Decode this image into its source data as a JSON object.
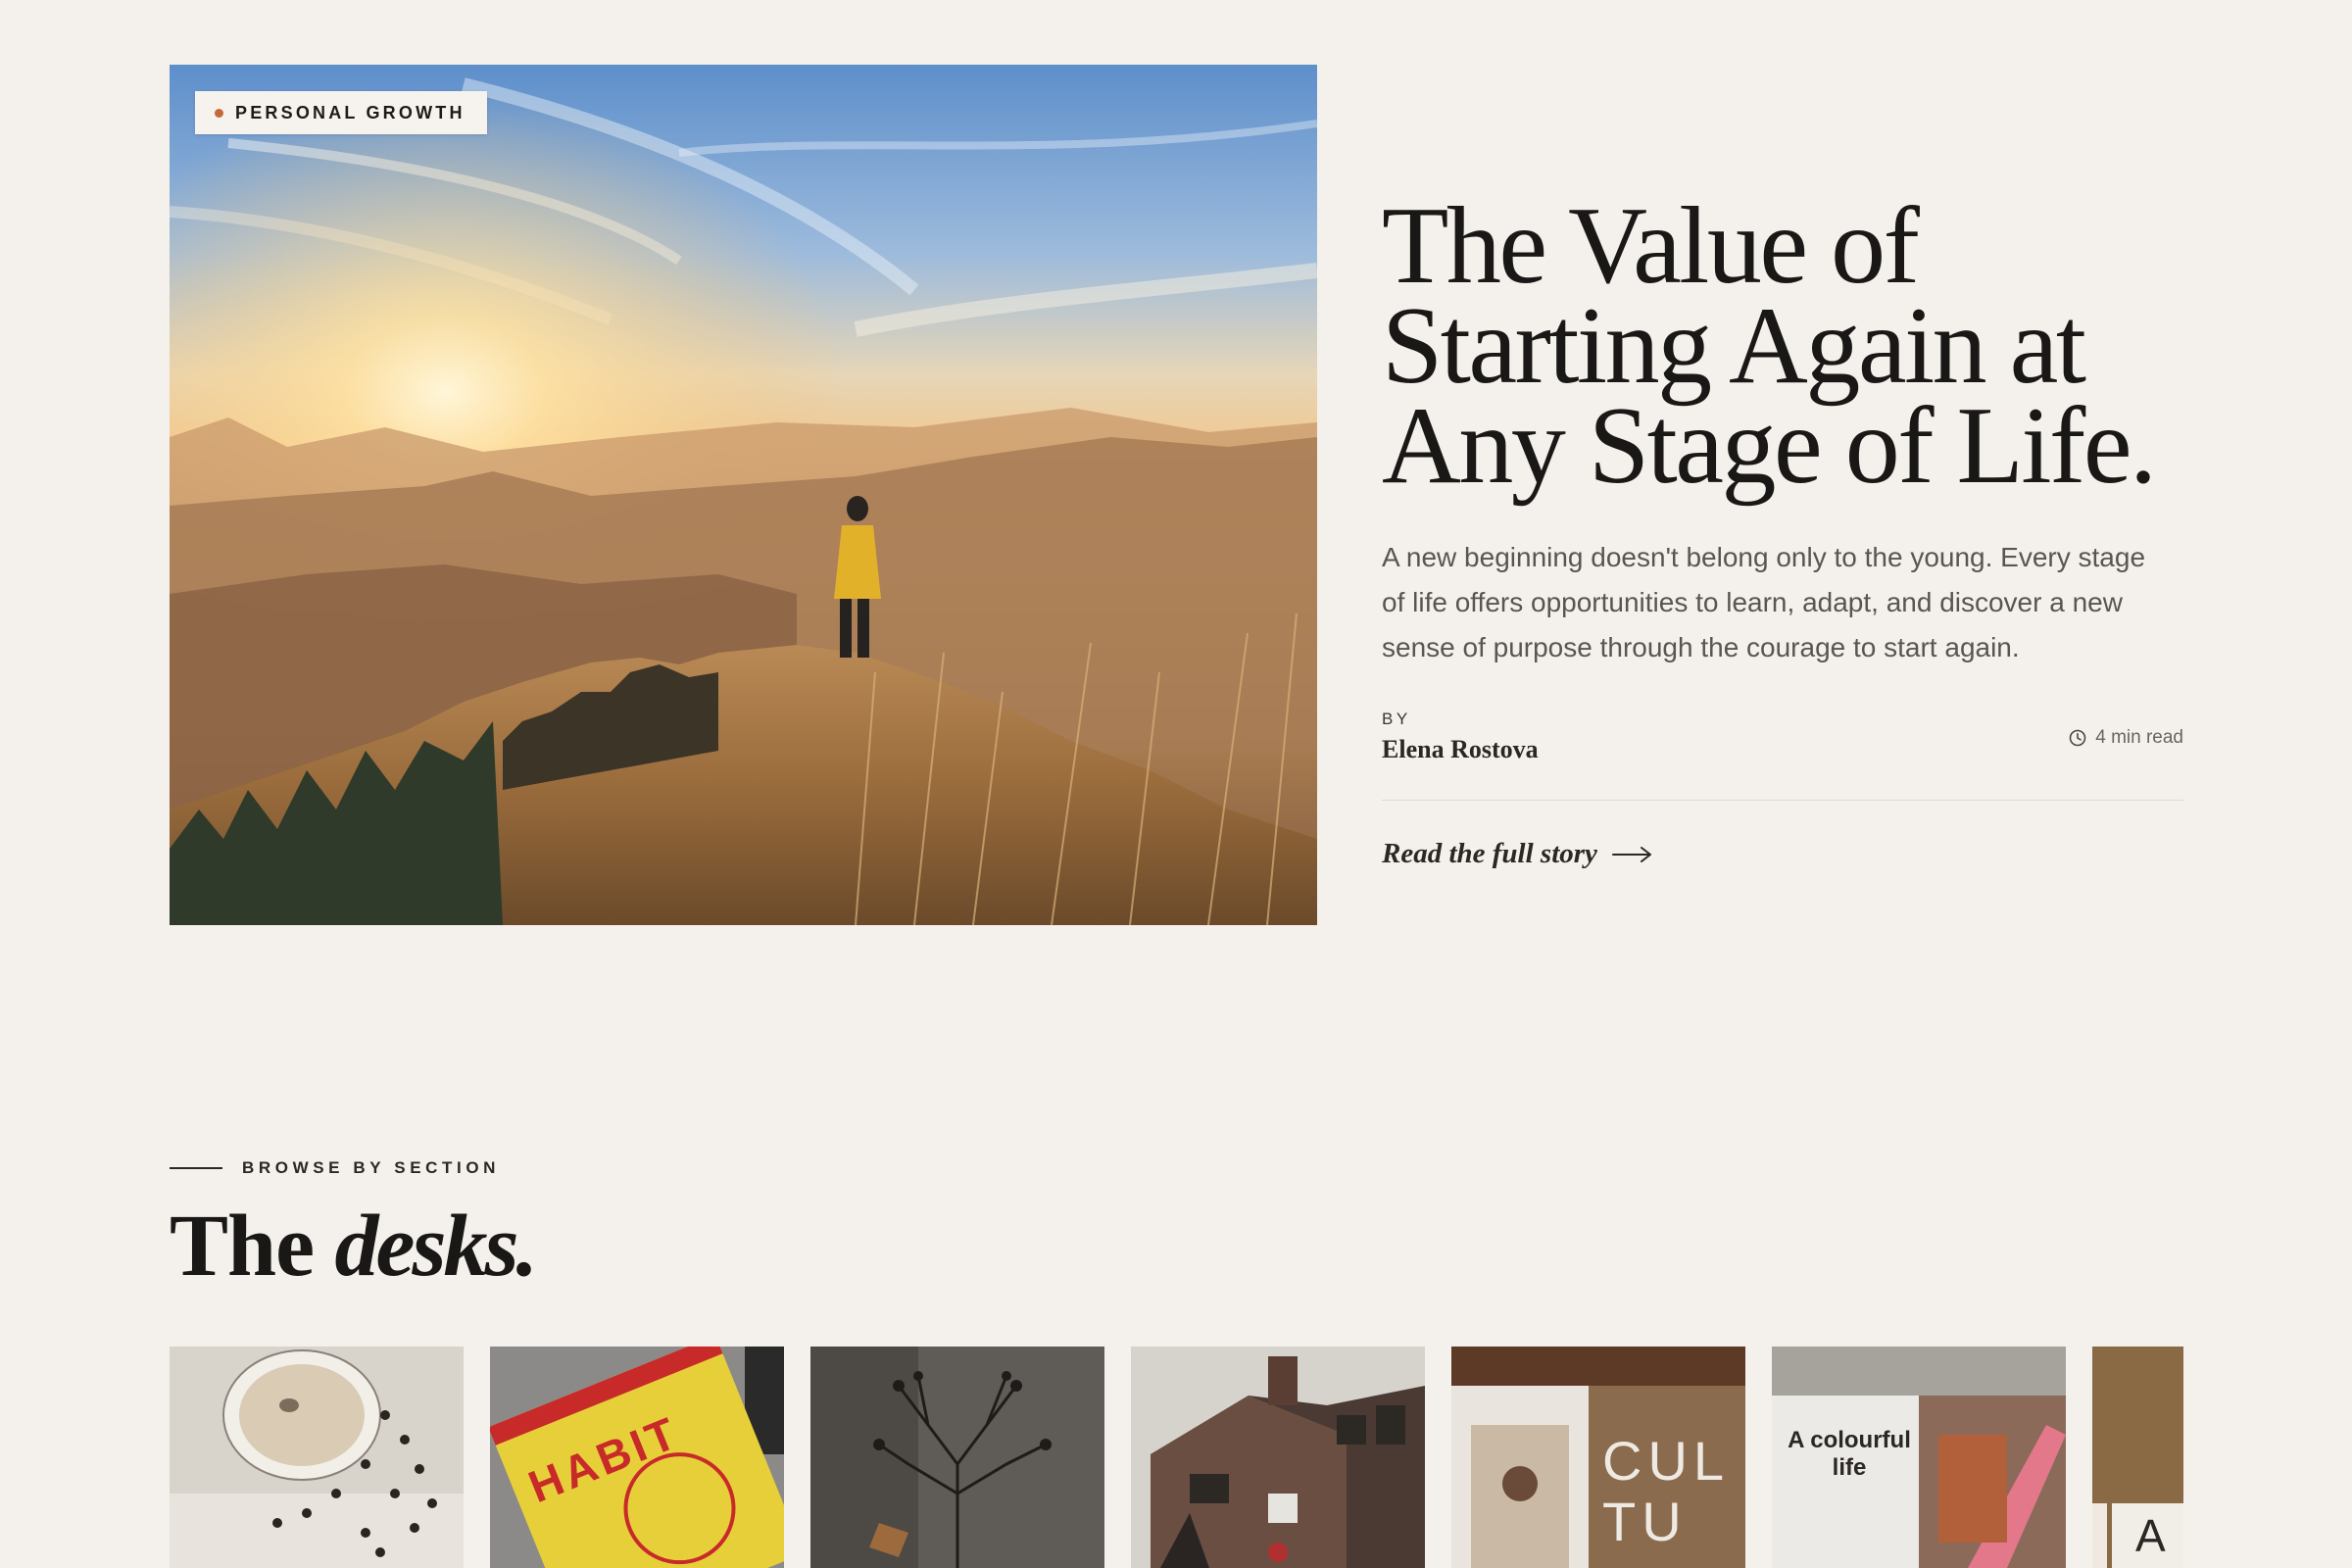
{
  "feature": {
    "category": "PERSONAL GROWTH",
    "headline": "The Value of Starting Again at Any Stage of Life.",
    "deck": "A new beginning doesn't belong only to the young. Every stage of life offers opportunities to learn, adapt, and discover a new sense of purpose through the courage to start again.",
    "by_label": "BY",
    "author": "Elena Rostova",
    "read_time": "4 min read",
    "read_more": "Read the full story",
    "accent_color": "#c4693a"
  },
  "browse": {
    "eyebrow": "BROWSE BY SECTION",
    "title_prefix": "The",
    "title_emphasis": "desks.",
    "cards": [
      {
        "image": "coffee-cup-and-beans",
        "text": ""
      },
      {
        "image": "power-of-habit-book",
        "text": "HABIT"
      },
      {
        "image": "dried-branch-silhouette",
        "text": ""
      },
      {
        "image": "brick-house",
        "text": ""
      },
      {
        "image": "culture-magazine",
        "text": "CUL TU"
      },
      {
        "image": "colourful-life-magazine",
        "text": "A colourful life"
      },
      {
        "image": "letter-tile",
        "text": "A"
      }
    ]
  }
}
